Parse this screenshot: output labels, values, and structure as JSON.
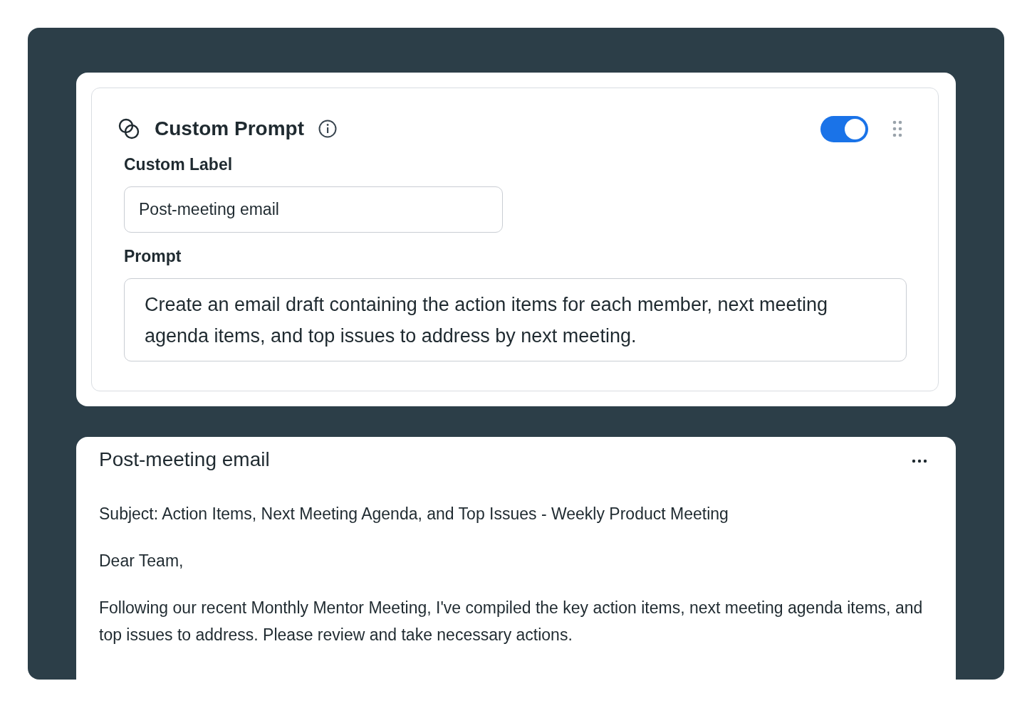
{
  "prompt_card": {
    "title": "Custom Prompt",
    "enabled": true,
    "label_heading": "Custom Label",
    "label_value": "Post-meeting email",
    "prompt_heading": "Prompt",
    "prompt_value": "Create an email draft containing the action items for each member, next meeting agenda items, and top issues to address by next meeting."
  },
  "result_card": {
    "title": "Post-meeting email",
    "paragraphs": [
      "Subject: Action Items, Next Meeting Agenda, and Top Issues - Weekly Product Meeting",
      "Dear Team,",
      "Following our recent Monthly Mentor Meeting, I've compiled the key action items, next meeting agenda items, and top issues to address. Please review and take necessary actions."
    ]
  }
}
